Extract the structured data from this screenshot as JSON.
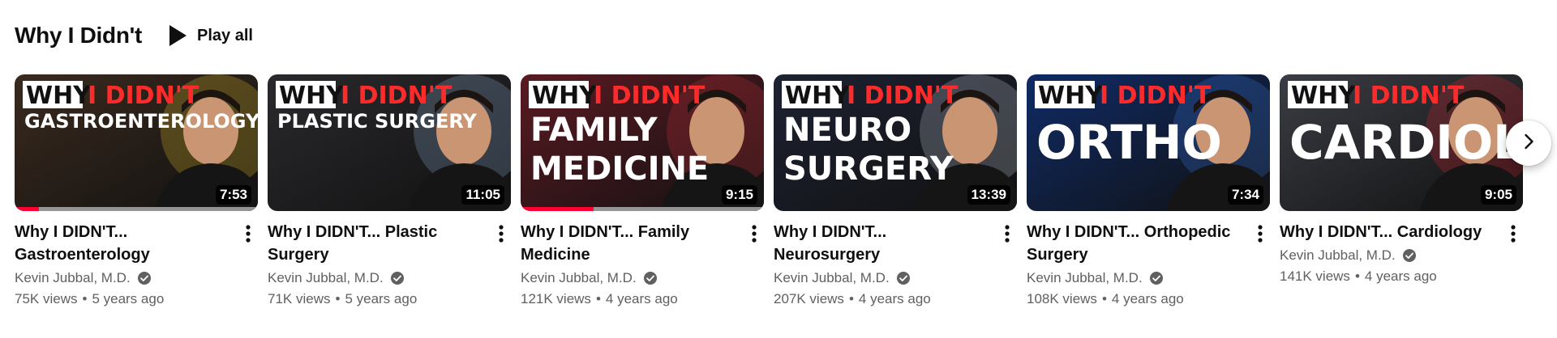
{
  "shelf": {
    "title": "Why I Didn't",
    "play_all_label": "Play all"
  },
  "videos": [
    {
      "title": "Why I DIDN'T... Gastroenterology",
      "channel": "Kevin Jubbal, M.D.",
      "views": "75K views",
      "age": "5 years ago",
      "duration": "7:53",
      "watched_fraction": 0.1,
      "thumb": {
        "line1_white": "WHY",
        "line1_red": "I DIDN'T",
        "line2": "GASTROENTEROLOGY",
        "line3": "",
        "bg": "#3a2a1e",
        "accent": "#e6c52a"
      }
    },
    {
      "title": "Why I DIDN'T... Plastic Surgery",
      "channel": "Kevin Jubbal, M.D.",
      "views": "71K views",
      "age": "5 years ago",
      "duration": "11:05",
      "watched_fraction": 0,
      "thumb": {
        "line1_white": "WHY",
        "line1_red": "I DIDN'T",
        "line2": "PLASTIC SURGERY",
        "line3": "",
        "bg": "#2a2a2e",
        "accent": "#8fb4d8"
      }
    },
    {
      "title": "Why I DIDN'T... Family Medicine",
      "channel": "Kevin Jubbal, M.D.",
      "views": "121K views",
      "age": "4 years ago",
      "duration": "9:15",
      "watched_fraction": 0.3,
      "thumb": {
        "line1_white": "WHY",
        "line1_red": "I DIDN'T",
        "line2": "FAMILY",
        "line3": "MEDICINE",
        "bg": "#5a1a22",
        "accent": "#c8323c"
      }
    },
    {
      "title": "Why I DIDN'T... Neurosurgery",
      "channel": "Kevin Jubbal, M.D.",
      "views": "207K views",
      "age": "4 years ago",
      "duration": "13:39",
      "watched_fraction": 0,
      "thumb": {
        "line1_white": "WHY",
        "line1_red": "I DIDN'T",
        "line2": "NEURO",
        "line3": "SURGERY",
        "bg": "#1d2232",
        "accent": "#c9cfdc"
      }
    },
    {
      "title": "Why I DIDN'T... Orthopedic Surgery",
      "channel": "Kevin Jubbal, M.D.",
      "views": "108K views",
      "age": "4 years ago",
      "duration": "7:34",
      "watched_fraction": 0,
      "thumb": {
        "line1_white": "WHY",
        "line1_red": "I DIDN'T",
        "line2": "ORTHO",
        "line3": "",
        "bg": "#0f2b66",
        "accent": "#3d7be0"
      }
    },
    {
      "title": "Why I DIDN'T... Cardiology",
      "channel": "Kevin Jubbal, M.D.",
      "views": "141K views",
      "age": "4 years ago",
      "duration": "9:05",
      "watched_fraction": 0,
      "thumb": {
        "line1_white": "WHY",
        "line1_red": "I DIDN'T",
        "line2": "CARDIOLOGY",
        "line3": "",
        "bg": "#3a3d44",
        "accent": "#e0242e"
      }
    }
  ],
  "icons": {
    "play": "play-icon",
    "verified": "verified-check-icon",
    "menu": "more-vert-icon",
    "next": "chevron-right-icon"
  },
  "colors": {
    "title_red": "#ff2b2b",
    "progress": "#ff0033",
    "secondary_text": "#606060"
  }
}
